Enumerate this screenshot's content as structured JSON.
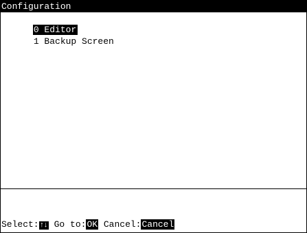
{
  "header": {
    "title": "Configuration"
  },
  "menu": {
    "items": [
      {
        "label": "0 Editor",
        "selected": true
      },
      {
        "label": "1 Backup Screen",
        "selected": false
      }
    ]
  },
  "footer": {
    "select_label": "Select:",
    "select_key": "↑↓",
    "goto_label": "Go to:",
    "goto_key": "OK",
    "cancel_label": "Cancel:",
    "cancel_key": "Cancel"
  },
  "colors": {
    "highlight_bg": "#000000",
    "highlight_fg": "#ffffff",
    "background": "#ffffff"
  }
}
